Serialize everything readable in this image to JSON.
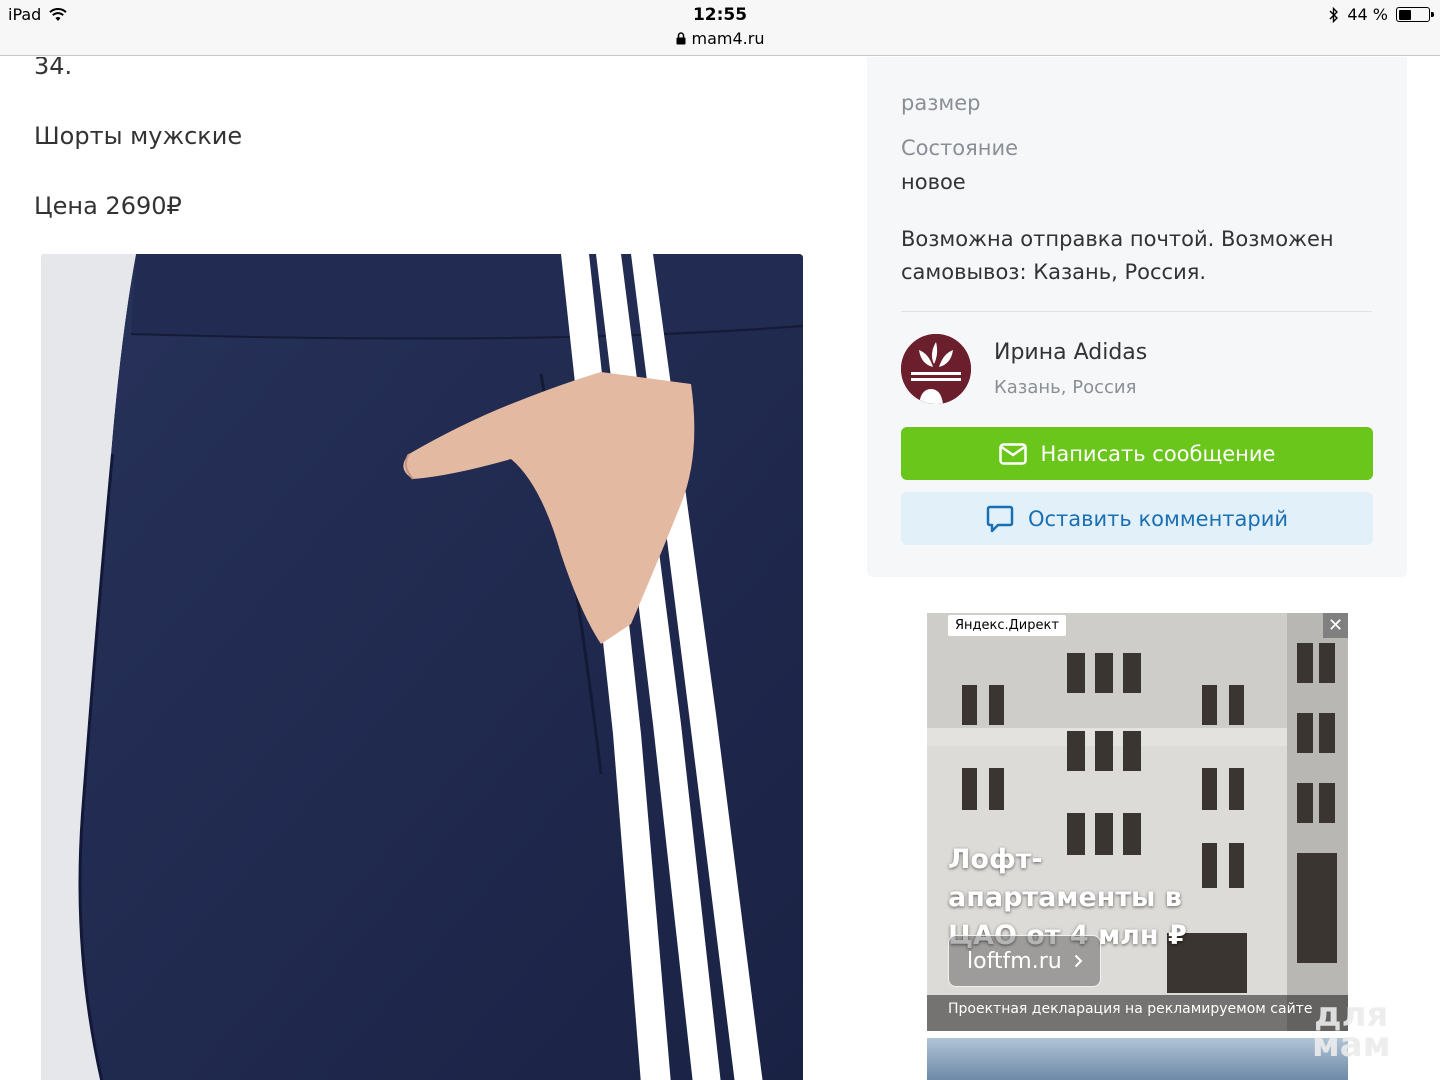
{
  "status_bar": {
    "device": "iPad",
    "time": "12:55",
    "url": "mam4.ru",
    "battery": "44 %",
    "battery_level": 0.44
  },
  "listing": {
    "number": "34.",
    "title": "Шорты мужские",
    "price": "Цена  2690₽"
  },
  "details": {
    "size_label": "размер",
    "condition_label": "Состояние",
    "condition_value": "новое",
    "delivery": "Возможна отправка почтой. Возможен самовывоз: Казань, Россия."
  },
  "seller": {
    "name": "Ирина Adidas",
    "city": "Казань, Россия"
  },
  "actions": {
    "message": "Написать сообщение",
    "comment": "Оставить комментарий"
  },
  "ad": {
    "label": "Яндекс.Директ",
    "close": "✕",
    "headline": "Лофт-апартаменты в ЦАО от 4 млн ₽",
    "link": "loftfm.ru",
    "footer": "Проектная декларация на рекламируемом сайте"
  },
  "watermark": {
    "line1": "для",
    "line2": "мам"
  },
  "colors": {
    "green": "#6bc61b",
    "light_blue": "#e2f0fa",
    "blue_text": "#1b6fb3"
  }
}
